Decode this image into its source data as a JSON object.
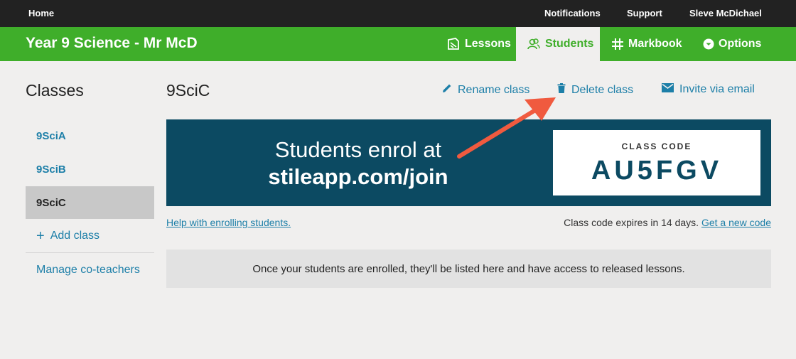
{
  "topbar": {
    "home": "Home",
    "notifications": "Notifications",
    "support": "Support",
    "user": "Sleve McDichael"
  },
  "header": {
    "course_title": "Year 9 Science - Mr McD",
    "nav": [
      {
        "label": "Lessons",
        "icon": "lessons-icon",
        "active": false
      },
      {
        "label": "Students",
        "icon": "students-icon",
        "active": true
      },
      {
        "label": "Markbook",
        "icon": "grid-icon",
        "active": false
      },
      {
        "label": "Options",
        "icon": "chevron-down-circle-icon",
        "active": false
      }
    ]
  },
  "sidebar": {
    "title": "Classes",
    "classes": [
      "9SciA",
      "9SciB",
      "9SciC"
    ],
    "selected": "9SciC",
    "add_class": "Add class",
    "manage": "Manage co-teachers"
  },
  "main": {
    "class_name": "9SciC",
    "actions": {
      "rename": "Rename class",
      "delete": "Delete class",
      "invite": "Invite via email"
    },
    "banner": {
      "line1": "Students enrol at",
      "line2": "stileapp.com/join",
      "code_label": "CLASS CODE",
      "code_value": "AU5FGV"
    },
    "help_link": "Help with enrolling students.",
    "expiry_text": "Class code expires in 14 days.",
    "new_code_link": "Get a new code",
    "empty_message": "Once your students are enrolled, they'll be listed here and have access to released lessons."
  },
  "colors": {
    "topbar": "#222222",
    "header_green": "#3fae2a",
    "banner_navy": "#0c4a62",
    "link_blue": "#1d7fa8",
    "annotation_arrow": "#f05a3f"
  }
}
